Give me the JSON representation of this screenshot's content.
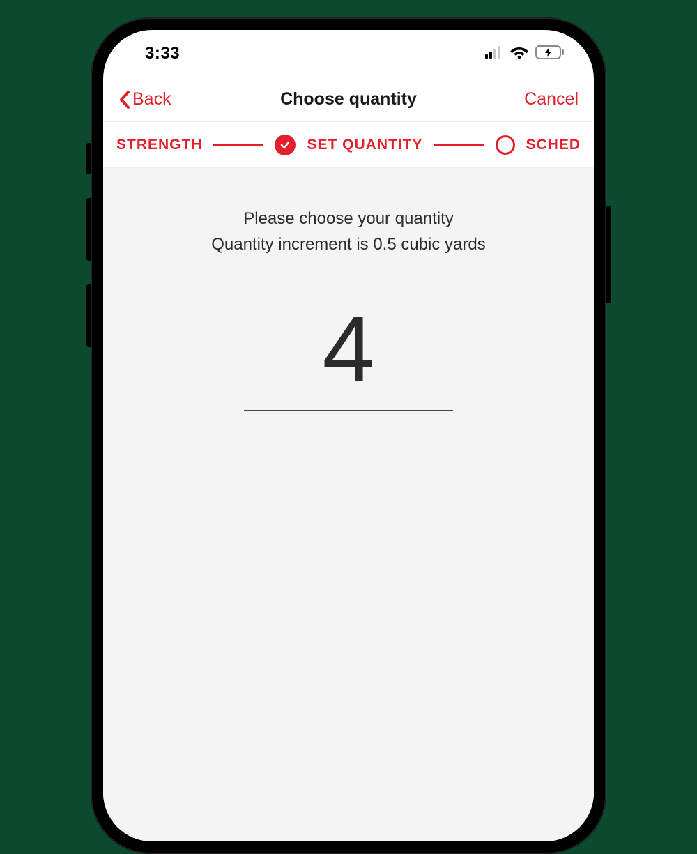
{
  "status": {
    "time": "3:33"
  },
  "nav": {
    "back_label": "Back",
    "title": "Choose quantity",
    "cancel_label": "Cancel"
  },
  "stepper": {
    "prev_label": "STRENGTH",
    "current_label": "SET QUANTITY",
    "next_label": "SCHED"
  },
  "content": {
    "line1": "Please choose your quantity",
    "line2": "Quantity increment is 0.5 cubic yards",
    "quantity_value": "4"
  },
  "colors": {
    "accent": "#e3202b"
  }
}
